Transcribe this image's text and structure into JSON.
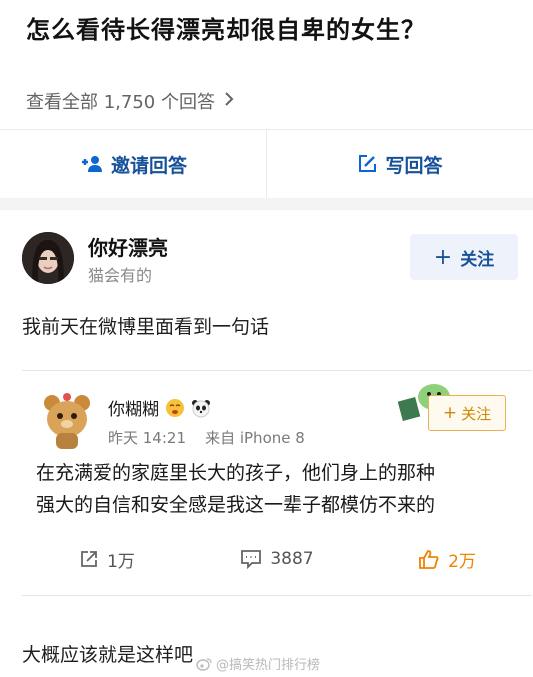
{
  "question": {
    "title": "怎么看待长得漂亮却很自卑的女生？"
  },
  "answers_link": {
    "label": "查看全部 1,750 个回答",
    "chevron_icon": "chevron-right-icon"
  },
  "actions": [
    {
      "label": "邀请回答",
      "icon": "add-user-icon"
    },
    {
      "label": "写回答",
      "icon": "edit-icon"
    }
  ],
  "author": {
    "name": "你好漂亮",
    "bio": "猫会有的",
    "follow_label": "关注"
  },
  "answer": {
    "paragraph_1": "我前天在微博里面看到一句话",
    "paragraph_2": "大概应该就是这样吧"
  },
  "weibo_post": {
    "user": "你糊糊",
    "time": "昨天 14:21",
    "source": "来自 iPhone 8",
    "follow_label": "关注",
    "text_line_1": "在充满爱的家庭里长大的孩子，他们身上的那种",
    "text_line_2": "强大的自信和安全感是我这一辈子都模仿不来的",
    "repost_count": "1万",
    "comment_count": "3887",
    "like_count": "2万"
  },
  "watermark": {
    "text": "@搞笑热门排行榜"
  },
  "colors": {
    "link_blue": "#175199",
    "icon_blue": "#0a66d0",
    "weibo_orange": "#f08300",
    "muted_gray": "#8a8a8a"
  }
}
